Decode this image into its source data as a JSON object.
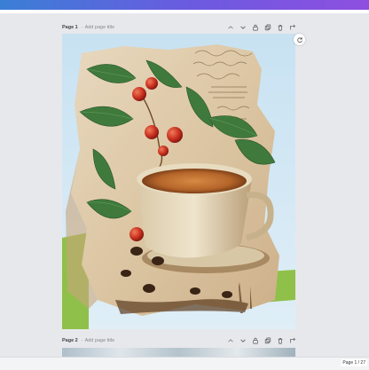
{
  "pages": [
    {
      "label": "Page 1",
      "separator": "-",
      "title_placeholder": "Add page title",
      "art": {
        "script_lines": [
          "Coffee",
          "Cafe",
          "Coffee"
        ],
        "note_lines": [
          "...",
          "..."
        ]
      }
    },
    {
      "label": "Page 2",
      "separator": "-",
      "title_placeholder": "Add page title"
    }
  ],
  "toolbar": {
    "icons": [
      "chevron-up-icon",
      "chevron-down-icon",
      "lock-icon",
      "duplicate-icon",
      "delete-icon",
      "add-page-icon"
    ]
  },
  "status_bar": {
    "page_counter": "Page 1 / 27"
  }
}
